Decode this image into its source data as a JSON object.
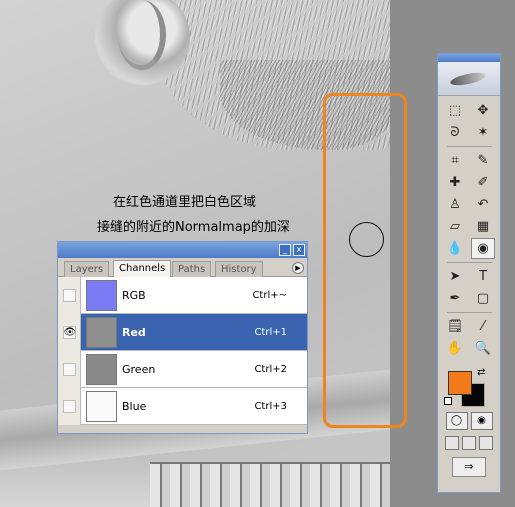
{
  "canvas": {
    "note_line1": "在红色通道里把白色区域",
    "note_line2": "接缝的附近的Normalmap的加深"
  },
  "channels_panel": {
    "title_buttons": [
      "_",
      "x"
    ],
    "tabs": [
      {
        "label": "Layers",
        "active": false
      },
      {
        "label": "Channels",
        "active": true
      },
      {
        "label": "Paths",
        "active": false
      },
      {
        "label": "History",
        "active": false
      }
    ],
    "menu_icon": "panel-menu-arrow-icon",
    "channels": [
      {
        "name": "RGB",
        "shortcut": "Ctrl+~",
        "visible": false,
        "selected": false,
        "thumb_color": "#7b7cf5"
      },
      {
        "name": "Red",
        "shortcut": "Ctrl+1",
        "visible": true,
        "selected": true,
        "thumb_color": "#8f8f8f"
      },
      {
        "name": "Green",
        "shortcut": "Ctrl+2",
        "visible": false,
        "selected": false,
        "thumb_color": "#8a8a8a"
      },
      {
        "name": "Blue",
        "shortcut": "Ctrl+3",
        "visible": false,
        "selected": false,
        "thumb_color": "#fafafa"
      }
    ]
  },
  "tools": {
    "items": [
      {
        "icon": "marquee-icon",
        "glyph": "⬚"
      },
      {
        "icon": "move-icon",
        "glyph": "✥"
      },
      {
        "icon": "lasso-icon",
        "glyph": "ᘐ"
      },
      {
        "icon": "magic-wand-icon",
        "glyph": "✶"
      },
      {
        "icon": "crop-icon",
        "glyph": "⌗"
      },
      {
        "icon": "slice-icon",
        "glyph": "✎"
      },
      {
        "icon": "healing-brush-icon",
        "glyph": "✚"
      },
      {
        "icon": "brush-icon",
        "glyph": "✐"
      },
      {
        "icon": "clone-stamp-icon",
        "glyph": "♙"
      },
      {
        "icon": "history-brush-icon",
        "glyph": "↶"
      },
      {
        "icon": "eraser-icon",
        "glyph": "▱"
      },
      {
        "icon": "gradient-icon",
        "glyph": "▦"
      },
      {
        "icon": "blur-icon",
        "glyph": "💧"
      },
      {
        "icon": "burn-icon",
        "glyph": "◉"
      },
      {
        "icon": "path-select-icon",
        "glyph": "➤"
      },
      {
        "icon": "type-icon",
        "glyph": "T"
      },
      {
        "icon": "pen-icon",
        "glyph": "✒"
      },
      {
        "icon": "shape-icon",
        "glyph": "▢"
      },
      {
        "icon": "notes-icon",
        "glyph": "🗒"
      },
      {
        "icon": "eyedropper-icon",
        "glyph": "⁄"
      },
      {
        "icon": "hand-icon",
        "glyph": "✋"
      },
      {
        "icon": "zoom-icon",
        "glyph": "🔍"
      }
    ],
    "foreground_color": "#f27a1a",
    "background_color": "#050505"
  }
}
